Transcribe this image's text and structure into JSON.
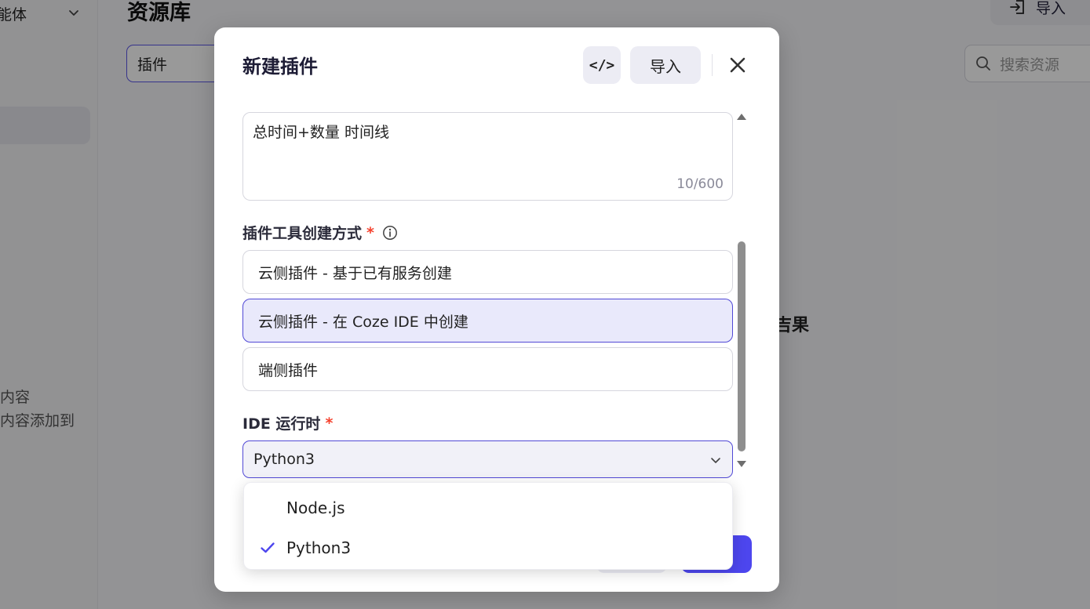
{
  "background": {
    "sidebar": {
      "agent_label": "能体",
      "tip_line1": "内容",
      "tip_line2": "内容添加到"
    },
    "page_title": "资源库",
    "import_label": "导入",
    "filter_value": "插件",
    "search_placeholder": "搜索资源",
    "empty_text": "吉果"
  },
  "modal": {
    "title": "新建插件",
    "code_button_label": "</>",
    "import_button_label": "导入",
    "description_value": "总时间+数量 时间线",
    "description_count": "10/600",
    "method_label": "插件工具创建方式",
    "required_mark": "*",
    "method_options": [
      {
        "label": "云侧插件 - 基于已有服务创建",
        "selected": false
      },
      {
        "label": "云侧插件 - 在 Coze IDE 中创建",
        "selected": true
      },
      {
        "label": "端侧插件",
        "selected": false
      }
    ],
    "runtime_label": "IDE 运行时",
    "runtime_value": "Python3"
  },
  "dropdown": {
    "options": [
      {
        "label": "Node.js",
        "checked": false
      },
      {
        "label": "Python3",
        "checked": true
      }
    ]
  },
  "colors": {
    "accent": "#4d46ee",
    "selected_bg": "#e9e9fb",
    "required": "#f5412d",
    "overlay": "rgba(0,0,0,0.40)"
  }
}
